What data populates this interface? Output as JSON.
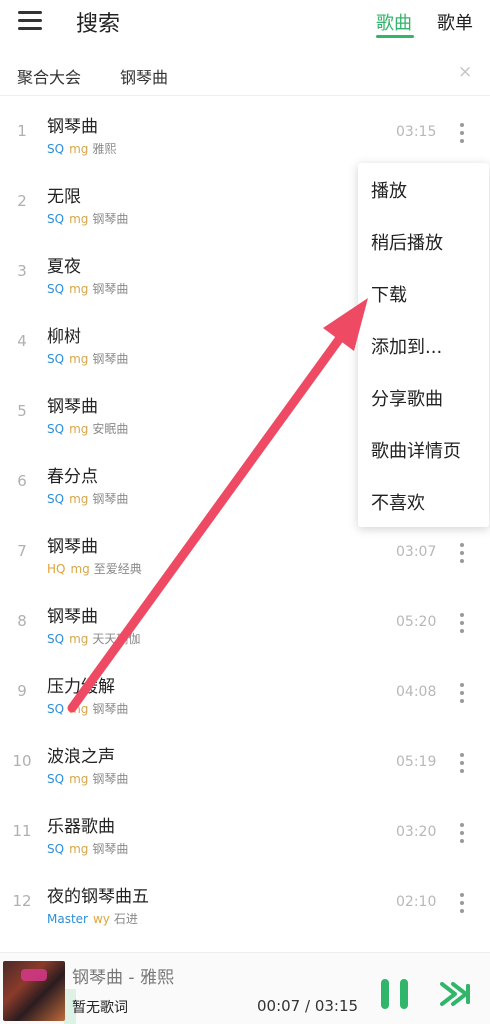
{
  "header": {
    "title": "搜索",
    "tabs": [
      "歌曲",
      "歌单"
    ]
  },
  "filter": {
    "aggregate": "聚合大会",
    "query": "钢琴曲",
    "clear": "×"
  },
  "songs": [
    {
      "num": "1",
      "title": "钢琴曲",
      "quality": "SQ",
      "source": "mg",
      "artist": "雅熙",
      "duration": "03:15"
    },
    {
      "num": "2",
      "title": "无限",
      "quality": "SQ",
      "source": "mg",
      "artist": "钢琴曲",
      "duration": ""
    },
    {
      "num": "3",
      "title": "夏夜",
      "quality": "SQ",
      "source": "mg",
      "artist": "钢琴曲",
      "duration": ""
    },
    {
      "num": "4",
      "title": "柳树",
      "quality": "SQ",
      "source": "mg",
      "artist": "钢琴曲",
      "duration": ""
    },
    {
      "num": "5",
      "title": "钢琴曲",
      "quality": "SQ",
      "source": "mg",
      "artist": "安眠曲",
      "duration": ""
    },
    {
      "num": "6",
      "title": "春分点",
      "quality": "SQ",
      "source": "mg",
      "artist": "钢琴曲",
      "duration": ""
    },
    {
      "num": "7",
      "title": "钢琴曲",
      "quality": "HQ",
      "source": "mg",
      "artist": "至爱经典",
      "duration": "03:07"
    },
    {
      "num": "8",
      "title": "钢琴曲",
      "quality": "SQ",
      "source": "mg",
      "artist": "天天瑜伽",
      "duration": "05:20"
    },
    {
      "num": "9",
      "title": "压力缓解",
      "quality": "SQ",
      "source": "mg",
      "artist": "钢琴曲",
      "duration": "04:08"
    },
    {
      "num": "10",
      "title": "波浪之声",
      "quality": "SQ",
      "source": "mg",
      "artist": "钢琴曲",
      "duration": "05:19"
    },
    {
      "num": "11",
      "title": "乐器歌曲",
      "quality": "SQ",
      "source": "mg",
      "artist": "钢琴曲",
      "duration": "03:20"
    },
    {
      "num": "12",
      "title": "夜的钢琴曲五",
      "quality": "Master",
      "source": "wy",
      "artist": "石进",
      "duration": "02:10"
    }
  ],
  "context_menu": [
    "播放",
    "稍后播放",
    "下载",
    "添加到...",
    "分享歌曲",
    "歌曲详情页",
    "不喜欢"
  ],
  "player": {
    "now_playing": "钢琴曲 - 雅熙",
    "lyrics": "暂无歌词",
    "time": "00:07 / 03:15",
    "progress": 0.04
  },
  "colors": {
    "accent": "#31b56a",
    "annotation_arrow": "#ef4a64"
  },
  "icons": {
    "menu": "hamburger-icon",
    "clear": "close-icon",
    "more": "more-vertical-icon",
    "pause": "pause-icon",
    "next": "skip-next-icon"
  }
}
